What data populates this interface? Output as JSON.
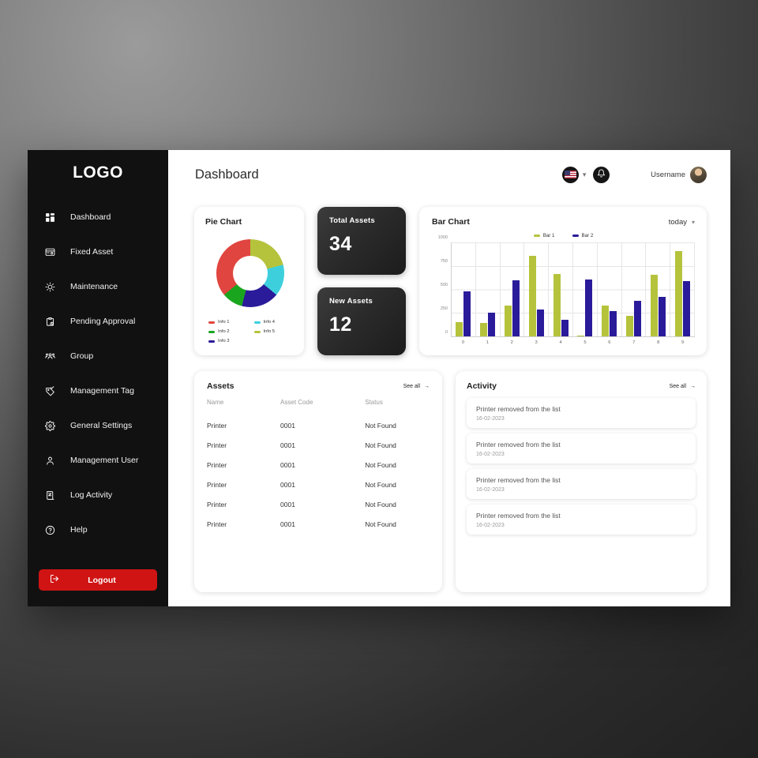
{
  "sidebar": {
    "logo": "LOGO",
    "items": [
      {
        "label": "Dashboard",
        "icon": "dashboard-grid-icon"
      },
      {
        "label": "Fixed Asset",
        "icon": "fixed-asset-icon"
      },
      {
        "label": "Maintenance",
        "icon": "maintenance-gear-icon",
        "ghost_label": "Main"
      },
      {
        "label": "Pending Approval",
        "icon": "clipboard-clock-icon"
      },
      {
        "label": "Group",
        "icon": "group-people-icon"
      },
      {
        "label": "Management Tag",
        "icon": "tag-check-icon"
      },
      {
        "label": "General Settings",
        "icon": "gear-icon"
      },
      {
        "label": "Management User",
        "icon": "user-icon"
      },
      {
        "label": "Log Activity",
        "icon": "log-activity-icon"
      },
      {
        "label": "Help",
        "icon": "help-circle-icon"
      }
    ],
    "logout_label": "Logout",
    "logout_icon": "logout-icon",
    "logout_color": "#d01414"
  },
  "header": {
    "title": "Dashboard",
    "language_icon": "us-flag-icon",
    "language_chevron_icon": "chevron-down-icon",
    "notification_icon": "bell-icon",
    "username": "Username",
    "avatar_icon": "avatar"
  },
  "pie_card": {
    "title": "Pie Chart"
  },
  "stats": [
    {
      "label": "Total Assets",
      "value": "34"
    },
    {
      "label": "New Assets",
      "value": "12"
    }
  ],
  "bar_card": {
    "title": "Bar Chart",
    "period": "today",
    "period_chevron_icon": "chevron-down-icon"
  },
  "assets": {
    "title": "Assets",
    "see_all": "See all",
    "see_all_icon": "arrow-right-icon",
    "columns": [
      "Name",
      "Asset Code",
      "Status"
    ],
    "rows": [
      [
        "Printer",
        "0001",
        "Not Found"
      ],
      [
        "Printer",
        "0001",
        "Not Found"
      ],
      [
        "Printer",
        "0001",
        "Not Found"
      ],
      [
        "Printer",
        "0001",
        "Not Found"
      ],
      [
        "Printer",
        "0001",
        "Not Found"
      ],
      [
        "Printer",
        "0001",
        "Not Found"
      ]
    ]
  },
  "activity": {
    "title": "Activity",
    "see_all": "See all",
    "see_all_icon": "arrow-right-icon",
    "items": [
      {
        "text": "Printer removed from the list",
        "date": "16-02-2023"
      },
      {
        "text": "Printer removed from the list",
        "date": "16-02-2023"
      },
      {
        "text": "Printer removed from the list",
        "date": "16-02-2023"
      },
      {
        "text": "Printer removed from the list",
        "date": "16-02-2023"
      }
    ]
  },
  "chart_data": [
    {
      "type": "pie",
      "title": "Pie Chart",
      "variant": "donut",
      "legend_position": "bottom",
      "labels": [
        "Info 1",
        "Info 2",
        "Info 3",
        "Info 4",
        "Info 5"
      ],
      "colors": [
        "#e0453f",
        "#1aa51f",
        "#2a1b9a",
        "#3ecfdd",
        "#b5c33c"
      ],
      "values": [
        36,
        10,
        18,
        15,
        21
      ],
      "start_angle_deg": 0,
      "direction": "clockwise",
      "segment_order": [
        "Info 5",
        "Info 4",
        "Info 3",
        "Info 2",
        "Info 1"
      ]
    },
    {
      "type": "bar",
      "title": "Bar Chart",
      "xlabel": "",
      "ylabel": "",
      "categories": [
        "0",
        "1",
        "2",
        "3",
        "4",
        "5",
        "6",
        "7",
        "8",
        "9"
      ],
      "yticks": [
        0,
        250,
        500,
        750,
        1000
      ],
      "ylim": [
        0,
        1000
      ],
      "grid": true,
      "legend_position": "top-center",
      "series": [
        {
          "name": "Bar 1",
          "color": "#b5c33c",
          "values": [
            155,
            145,
            330,
            860,
            665,
            5,
            325,
            220,
            655,
            910
          ]
        },
        {
          "name": "Bar 2",
          "color": "#2a1b9a",
          "values": [
            480,
            255,
            595,
            290,
            180,
            605,
            265,
            375,
            420,
            590
          ]
        }
      ]
    }
  ]
}
